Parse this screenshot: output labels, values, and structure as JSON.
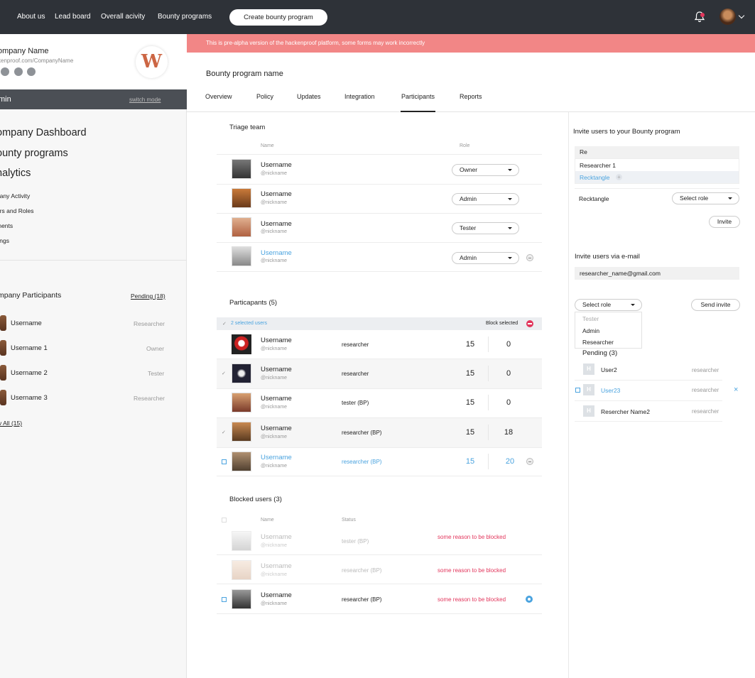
{
  "nav": {
    "items": [
      "About us",
      "Lead board",
      "Overall acivity",
      "Bounty programs"
    ],
    "create_button": "Create bounty program"
  },
  "sidebar": {
    "company_name": "ompany Name",
    "company_url": "kenproof.com/CompanyName",
    "logo_letter": "W",
    "mode_label": "min",
    "switch_mode": "switch mode",
    "big_menu": [
      "ompany Dashboard",
      "ounty programs",
      "nalytics"
    ],
    "small_menu": [
      "pany Activity",
      "ers and Roles",
      "ments",
      "tings"
    ],
    "participants_title": "mpany Participants",
    "pending": "Pending (18)",
    "participants": [
      {
        "name": "Username",
        "role": "Researcher"
      },
      {
        "name": "Username 1",
        "role": "Owner"
      },
      {
        "name": "Username 2",
        "role": "Tester"
      },
      {
        "name": "Username 3",
        "role": "Researcher"
      }
    ],
    "view_all": "v All (15)"
  },
  "banner": "This is pre-alpha version of the hackenproof platform, some forms may work incorrectly",
  "program_name": "Bounty program name",
  "tabs": [
    "Overview",
    "Policy",
    "Updates",
    "Integration",
    "Participants",
    "Reports"
  ],
  "triage": {
    "title": "Triage team",
    "col_name": "Name",
    "col_role": "Role",
    "rows": [
      {
        "name": "Username",
        "nick": "@nickname",
        "role": "Owner"
      },
      {
        "name": "Username",
        "nick": "@nickname",
        "role": "Admin"
      },
      {
        "name": "Username",
        "nick": "@nickname",
        "role": "Tester"
      },
      {
        "name": "Username",
        "nick": "@nickname",
        "role": "Admin"
      }
    ]
  },
  "participants": {
    "title": "Particapants (5)",
    "selected": "2 selected users",
    "block_selected": "Block selected",
    "rows": [
      {
        "name": "Username",
        "nick": "@nickname",
        "status": "researcher",
        "a": "15",
        "b": "0"
      },
      {
        "name": "Username",
        "nick": "@nickname",
        "status": "researcher",
        "a": "15",
        "b": "0"
      },
      {
        "name": "Username",
        "nick": "@nickname",
        "status": "tester (BP)",
        "a": "15",
        "b": "0"
      },
      {
        "name": "Username",
        "nick": "@nickname",
        "status": "researcher (BP)",
        "a": "15",
        "b": "18"
      },
      {
        "name": "Username",
        "nick": "@nickname",
        "status": "researcher (BP)",
        "a": "15",
        "b": "20"
      }
    ]
  },
  "blocked": {
    "title": "Blocked users (3)",
    "col_name": "Name",
    "col_status": "Status",
    "rows": [
      {
        "name": "Username",
        "nick": "@nickname",
        "status": "tester (BP)",
        "reason": "some reason to be blocked"
      },
      {
        "name": "Username",
        "nick": "@nickname",
        "status": "researcher (BP)",
        "reason": "some reason to be blocked"
      },
      {
        "name": "Username",
        "nick": "@nickname",
        "status": "researcher (BP)",
        "reason": "some reason to be blocked"
      }
    ]
  },
  "invite": {
    "title": "Invite users to your Bounty program",
    "search_value": "Re",
    "suggestions": [
      "Researcher 1",
      "Recktangle"
    ],
    "selected_user": "Recktangle",
    "select_role": "Select role",
    "invite_button": "Invite",
    "email_title": "Invite users via e-mail",
    "email_value": "researcher_name@gmail.com",
    "select_role2": "Select role",
    "send_invite": "Send invite",
    "role_options": [
      "Tester",
      "Admin",
      "Researcher"
    ],
    "pending_title": "Pending (3)",
    "pending": [
      {
        "letter": "H",
        "name": "User2",
        "role": "researcher"
      },
      {
        "letter": "H",
        "name": "User23",
        "role": "researcher"
      },
      {
        "letter": "H",
        "name": "Resercher Name2",
        "role": "researcher"
      }
    ]
  },
  "colors": {
    "nav_bg": "#2e3238",
    "banner": "#f28686",
    "accent": "#4aa3df",
    "danger": "#e2365c"
  }
}
